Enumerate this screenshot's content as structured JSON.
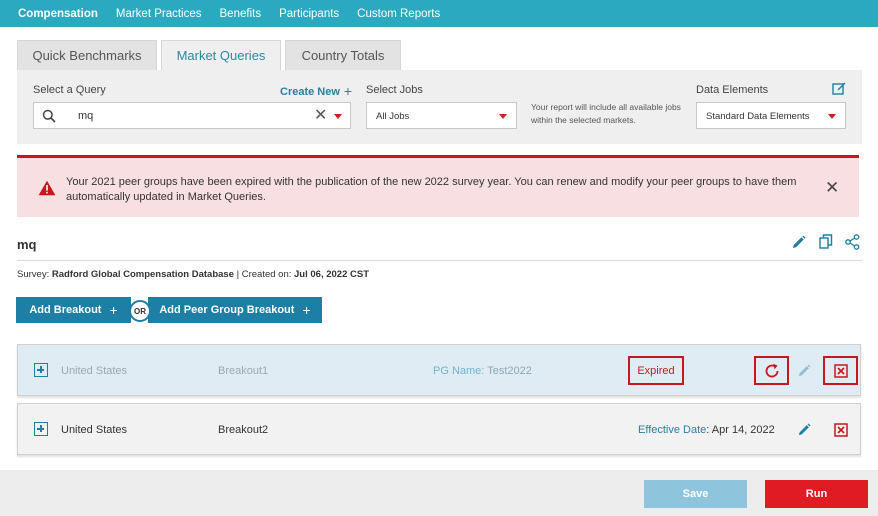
{
  "nav": {
    "items": [
      {
        "label": "Compensation",
        "active": true
      },
      {
        "label": "Market Practices",
        "active": false
      },
      {
        "label": "Benefits",
        "active": false
      },
      {
        "label": "Participants",
        "active": false
      },
      {
        "label": "Custom Reports",
        "active": false
      }
    ]
  },
  "tabs": [
    {
      "label": "Quick Benchmarks",
      "active": false
    },
    {
      "label": "Market Queries",
      "active": true
    },
    {
      "label": "Country Totals",
      "active": false
    }
  ],
  "query_panel": {
    "select_query_label": "Select a Query",
    "create_new_label": "Create New",
    "query_value": "mq",
    "select_jobs_label": "Select Jobs",
    "jobs_value": "All Jobs",
    "note": "Your report will include all available jobs within the selected markets.",
    "data_elements_label": "Data Elements",
    "data_elements_value": "Standard Data Elements"
  },
  "alert": {
    "text": "Your 2021 peer groups have been expired with the publication of the new 2022 survey year. You can renew and modify your peer groups to have them automatically updated in Market Queries."
  },
  "query": {
    "title": "mq",
    "survey_label": "Survey:",
    "survey_name": "Radford Global Compensation Database",
    "separator": " | Created on:",
    "created_on": "Jul 06, 2022 CST"
  },
  "breakout_buttons": {
    "add_breakout": "Add Breakout",
    "or": "OR",
    "add_peer_group": "Add Peer Group Breakout"
  },
  "rows": [
    {
      "country": "United States",
      "breakout": "Breakout1",
      "pg_label": "PG Name:",
      "pg_value": "Test2022",
      "status": "Expired"
    },
    {
      "country": "United States",
      "breakout": "Breakout2",
      "effective_label": "Effective Date",
      "effective_value": ": Apr 14, 2022"
    }
  ],
  "footer": {
    "save_label": "Save",
    "run_label": "Run"
  },
  "colors": {
    "nav": "#2aa9c1",
    "accent": "#1d7ea6",
    "alert_red": "#c8161d",
    "run_red": "#e01b24",
    "save_blue": "#8fc5dc"
  }
}
